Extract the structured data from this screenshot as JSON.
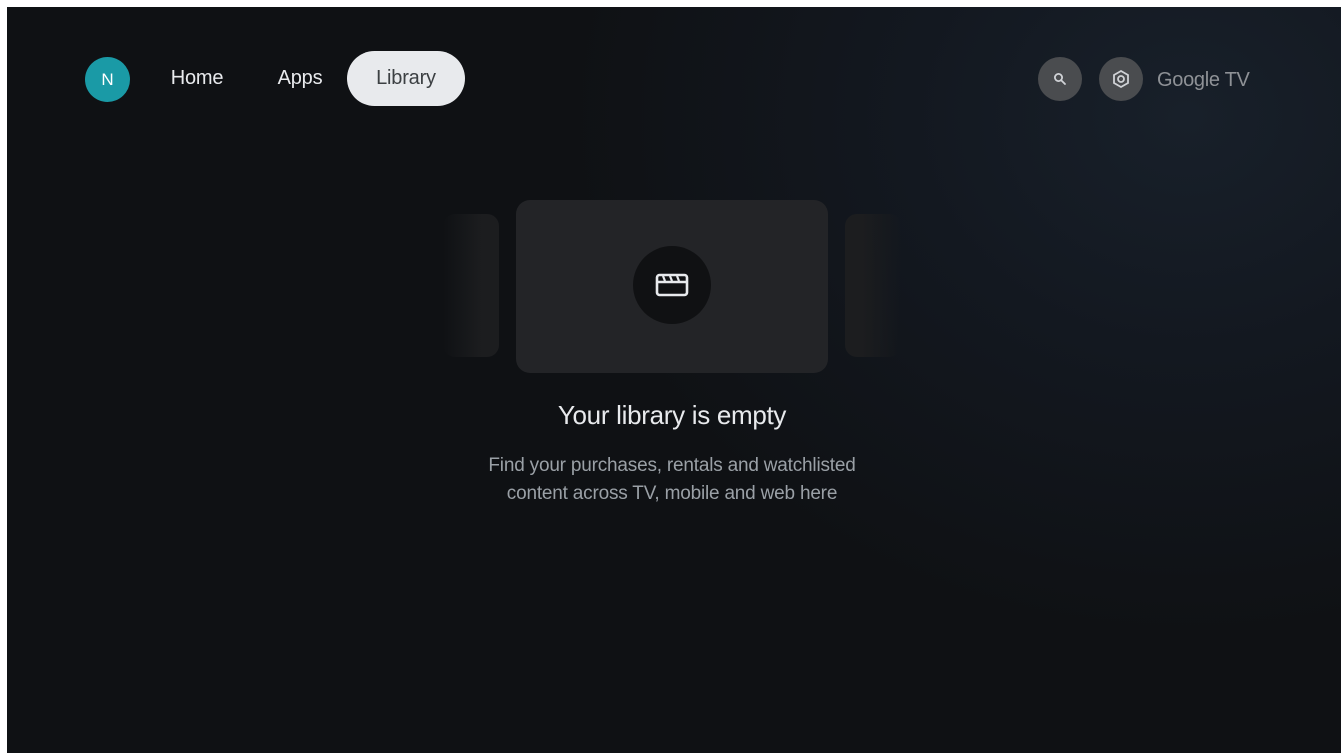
{
  "header": {
    "avatar_initial": "N",
    "tabs": [
      {
        "label": "Home",
        "selected": false
      },
      {
        "label": "Apps",
        "selected": false
      },
      {
        "label": "Library",
        "selected": true
      }
    ],
    "search_icon": "search-icon",
    "settings_icon": "gear-icon",
    "brand": "Google TV"
  },
  "library": {
    "card_icon": "clapperboard-icon",
    "title": "Your library is empty",
    "subtitle_lines": [
      "Find your purchases, rentals and watchlisted",
      "content across TV, mobile and web here"
    ]
  },
  "colors": {
    "avatar": "#1a9aa6",
    "selected_tab_bg": "#e8eaed",
    "background": "#0f1114"
  }
}
